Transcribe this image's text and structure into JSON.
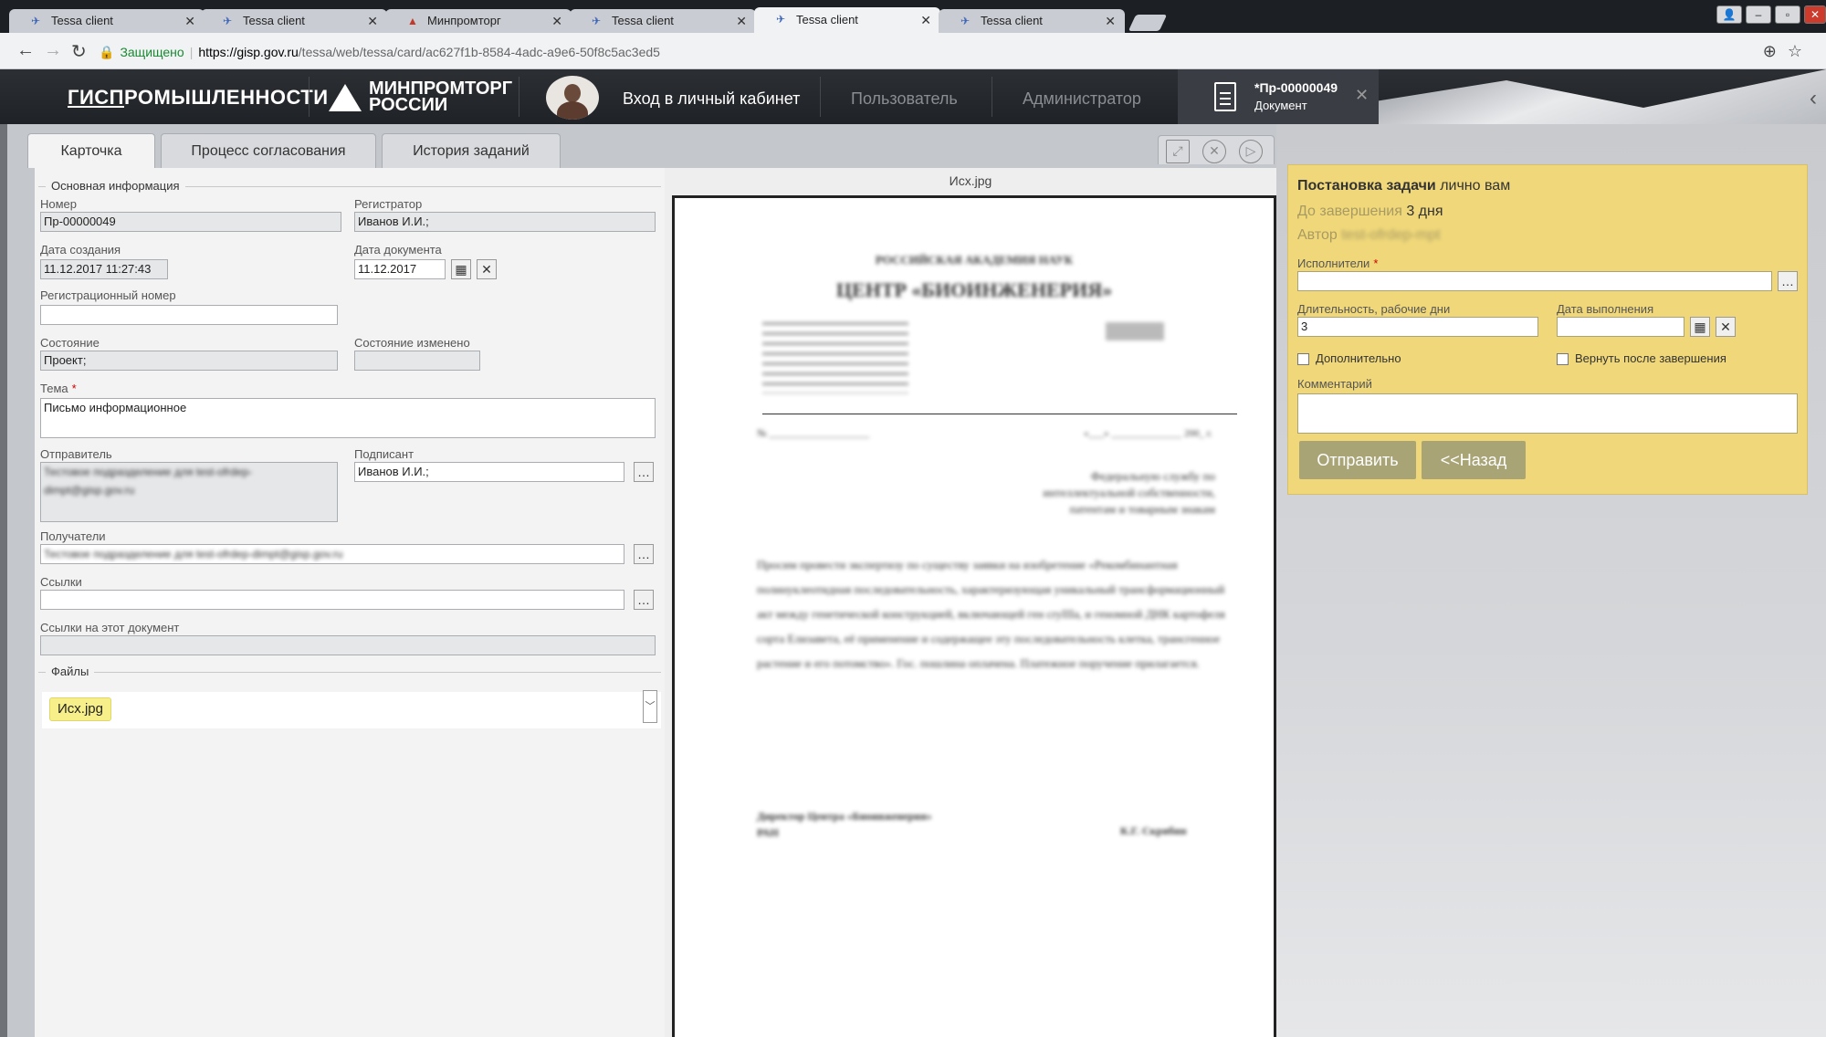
{
  "browser": {
    "tabs": [
      {
        "label": "Tessa client"
      },
      {
        "label": "Tessa client"
      },
      {
        "label": "Минпромторг"
      },
      {
        "label": "Tessa client"
      },
      {
        "label": "Tessa client"
      },
      {
        "label": "Tessa client"
      }
    ],
    "address": {
      "secure_label": "Защищено",
      "host": "https://gisp.gov.ru",
      "path": "/tessa/web/tessa/card/ac627f1b-8584-4adc-a9e6-50f8c5ac3ed5"
    }
  },
  "header": {
    "brand_prefix": "ГИСП",
    "brand_rest": "РОМЫШЛЕННОСТИ",
    "ministry_line1": "МИНПРОМТОРГ",
    "ministry_line2": "РОССИИ",
    "links": {
      "cabinet": "Вход в личный кабинет",
      "user": "Пользователь",
      "admin": "Администратор"
    },
    "doc_tab": {
      "number": "*Пр-00000049",
      "type": "Документ"
    }
  },
  "card_tabs": [
    "Карточка",
    "Процесс согласования",
    "История заданий"
  ],
  "form": {
    "section_main": "Основная информация",
    "number_label": "Номер",
    "number_value": "Пр-00000049",
    "registrar_label": "Регистратор",
    "registrar_value": "Иванов И.И.;",
    "created_label": "Дата создания",
    "created_value": "11.12.2017 11:27:43",
    "docdate_label": "Дата документа",
    "docdate_value": "11.12.2017",
    "regnum_label": "Регистрационный номер",
    "regnum_value": "",
    "state_label": "Состояние",
    "state_value": "Проект;",
    "state_changed_label": "Состояние изменено",
    "state_changed_value": "",
    "subject_label": "Тема",
    "subject_value": "Письмо информационное",
    "sender_label": "Отправитель",
    "sender_value": "Тестовое подразделение для test-ofrdep-dimpt@gisp.gov.ru",
    "signer_label": "Подписант",
    "signer_value": "Иванов И.И.;",
    "recipients_label": "Получатели",
    "recipients_value": "Тестовое подразделение для test-ofrdep-dimpt@gisp.gov.ru",
    "links_label": "Ссылки",
    "links_value": "",
    "backlinks_label": "Ссылки на этот документ",
    "backlinks_value": "",
    "section_files": "Файлы",
    "file_name": "Исх.jpg"
  },
  "viewer": {
    "title": "Исх.jpg",
    "doc": {
      "org_line1": "РОССИЙСКАЯ АКАДЕМИЯ НАУК",
      "org_line2": "ЦЕНТР «БИОИНЖЕНЕРИЯ»",
      "number_line": "№ ____________________",
      "date_line": "«___» ______________ 200_ г.",
      "addressee": "Федеральную службу по интеллектуальной собственности, патентам и товарным знакам",
      "body": "Просим провести экспертизу по существу заявки на изобретение «Рекомбинантная полинуклеотидная последовательность, характеризующая уникальный трансформационный акт между генетической конструкцией, включающей ген cryIIIa, и геномной ДНК картофеля сорта Елизавета, её применение и содержащее эту последовательность клетка, трансгенное растение и его потомство». Гос. пошлина оплачена. Платежное поручение прилагается.",
      "signature_role": "Директор Центра «Биоинженерия» РАН",
      "signature_name": "К.Г. Скрябин"
    }
  },
  "task": {
    "title_bold": "Постановка задачи",
    "title_rest": " лично вам",
    "until_label": "До завершения ",
    "until_value": "3 дня",
    "author_label": "Автор ",
    "author_value": "test-ofrdep-mpt",
    "performers_label": "Исполнители",
    "performers_value": "",
    "duration_label": "Длительность, рабочие дни",
    "duration_value": "3",
    "due_label": "Дата выполнения",
    "due_value": "",
    "extra_label": "Дополнительно",
    "return_label": "Вернуть после завершения",
    "comment_label": "Комментарий",
    "comment_value": "",
    "send_button": "Отправить",
    "back_button": "<<Назад"
  }
}
